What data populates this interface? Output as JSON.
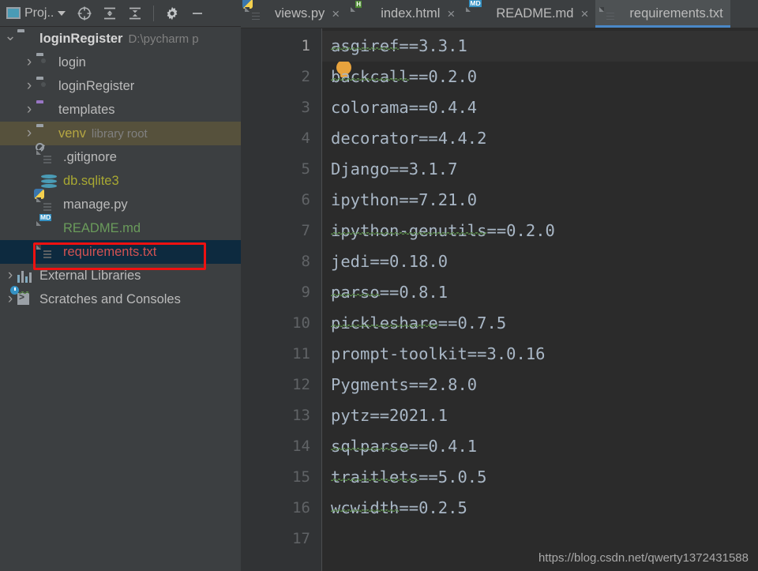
{
  "sidebar": {
    "toolbar": {
      "title": "Proj..",
      "icons": [
        {
          "name": "locate-icon",
          "glyph": "target"
        },
        {
          "name": "expand-all-icon",
          "glyph": "expand"
        },
        {
          "name": "collapse-all-icon",
          "glyph": "collapse"
        },
        {
          "name": "settings-gear-icon",
          "glyph": "gear"
        },
        {
          "name": "hide-panel-icon",
          "glyph": "minus"
        }
      ]
    },
    "tree": [
      {
        "label": "loginRegister",
        "secondary": "D:\\pycharm p",
        "icon": "folder-icon",
        "arrow": "down",
        "indent": 0,
        "style": "bold"
      },
      {
        "label": "login",
        "secondary": "",
        "icon": "folder-module-icon",
        "arrow": "right",
        "indent": 1,
        "style": "normal"
      },
      {
        "label": "loginRegister",
        "secondary": "",
        "icon": "folder-module-icon",
        "arrow": "right",
        "indent": 1,
        "style": "normal"
      },
      {
        "label": "templates",
        "secondary": "",
        "icon": "folder-templates-icon",
        "arrow": "right",
        "indent": 1,
        "style": "normal"
      },
      {
        "label": "venv",
        "secondary": "library root",
        "icon": "folder-icon",
        "arrow": "right",
        "indent": 1,
        "style": "olive"
      },
      {
        "label": ".gitignore",
        "secondary": "",
        "icon": "gitignore-file-icon",
        "arrow": "none",
        "indent": 2,
        "style": "normal"
      },
      {
        "label": "db.sqlite3",
        "secondary": "",
        "icon": "database-file-icon",
        "arrow": "none",
        "indent": 2,
        "style": "yellowgreen"
      },
      {
        "label": "manage.py",
        "secondary": "",
        "icon": "python-file-icon",
        "arrow": "none",
        "indent": 2,
        "style": "normal"
      },
      {
        "label": "README.md",
        "secondary": "",
        "icon": "markdown-file-icon",
        "arrow": "none",
        "indent": 2,
        "style": "green"
      },
      {
        "label": "requirements.txt",
        "secondary": "",
        "icon": "text-file-icon",
        "arrow": "none",
        "indent": 2,
        "style": "red"
      },
      {
        "label": "External Libraries",
        "secondary": "",
        "icon": "libraries-icon",
        "arrow": "right",
        "indent": 0,
        "style": "normal"
      },
      {
        "label": "Scratches and Consoles",
        "secondary": "",
        "icon": "scratches-icon",
        "arrow": "right",
        "indent": 0,
        "style": "normal"
      }
    ]
  },
  "editor": {
    "tabs": [
      {
        "label": "views.py",
        "icon": "python-file-icon",
        "closable": true,
        "active": false
      },
      {
        "label": "index.html",
        "icon": "html-file-icon",
        "closable": true,
        "active": false
      },
      {
        "label": "README.md",
        "icon": "markdown-file-icon",
        "closable": true,
        "active": false
      },
      {
        "label": "requirements.txt",
        "icon": "text-file-icon",
        "closable": false,
        "active": true
      }
    ],
    "close_glyph": "×",
    "lines": [
      {
        "n": "1",
        "text": "asgiref==3.3.1",
        "squiggle_len": 7
      },
      {
        "n": "2",
        "text": "backcall==0.2.0",
        "squiggle_len": 8
      },
      {
        "n": "3",
        "text": "colorama==0.4.4",
        "squiggle_len": 0
      },
      {
        "n": "4",
        "text": "decorator==4.4.2",
        "squiggle_len": 0
      },
      {
        "n": "5",
        "text": "Django==3.1.7",
        "squiggle_len": 0
      },
      {
        "n": "6",
        "text": "ipython==7.21.0",
        "squiggle_len": 0
      },
      {
        "n": "7",
        "text": "ipython-genutils==0.2.0",
        "squiggle_len": 16
      },
      {
        "n": "8",
        "text": "jedi==0.18.0",
        "squiggle_len": 0
      },
      {
        "n": "9",
        "text": "parso==0.8.1",
        "squiggle_len": 5
      },
      {
        "n": "10",
        "text": "pickleshare==0.7.5",
        "squiggle_len": 11
      },
      {
        "n": "11",
        "text": "prompt-toolkit==3.0.16",
        "squiggle_len": 0
      },
      {
        "n": "12",
        "text": "Pygments==2.8.0",
        "squiggle_len": 0
      },
      {
        "n": "13",
        "text": "pytz==2021.1",
        "squiggle_len": 0
      },
      {
        "n": "14",
        "text": "sqlparse==0.4.1",
        "squiggle_len": 8
      },
      {
        "n": "15",
        "text": "traitlets==5.0.5",
        "squiggle_len": 9
      },
      {
        "n": "16",
        "text": "wcwidth==0.2.5",
        "squiggle_len": 7
      },
      {
        "n": "17",
        "text": "",
        "squiggle_len": 0
      }
    ],
    "current_line": 1,
    "intention_bulb": "lightbulb-icon"
  },
  "watermark": "https://blog.csdn.net/qwerty1372431588",
  "colors": {
    "panel_bg": "#3c3f41",
    "editor_bg": "#2b2b2b",
    "gutter_bg": "#313335",
    "code_fg": "#a9b7c6",
    "accent_tab": "#4a88c7",
    "selection_bg": "#0d2a3f",
    "venv_bg": "#56513c",
    "annotation_red": "#ee1111",
    "bulb": "#e8a33d"
  }
}
